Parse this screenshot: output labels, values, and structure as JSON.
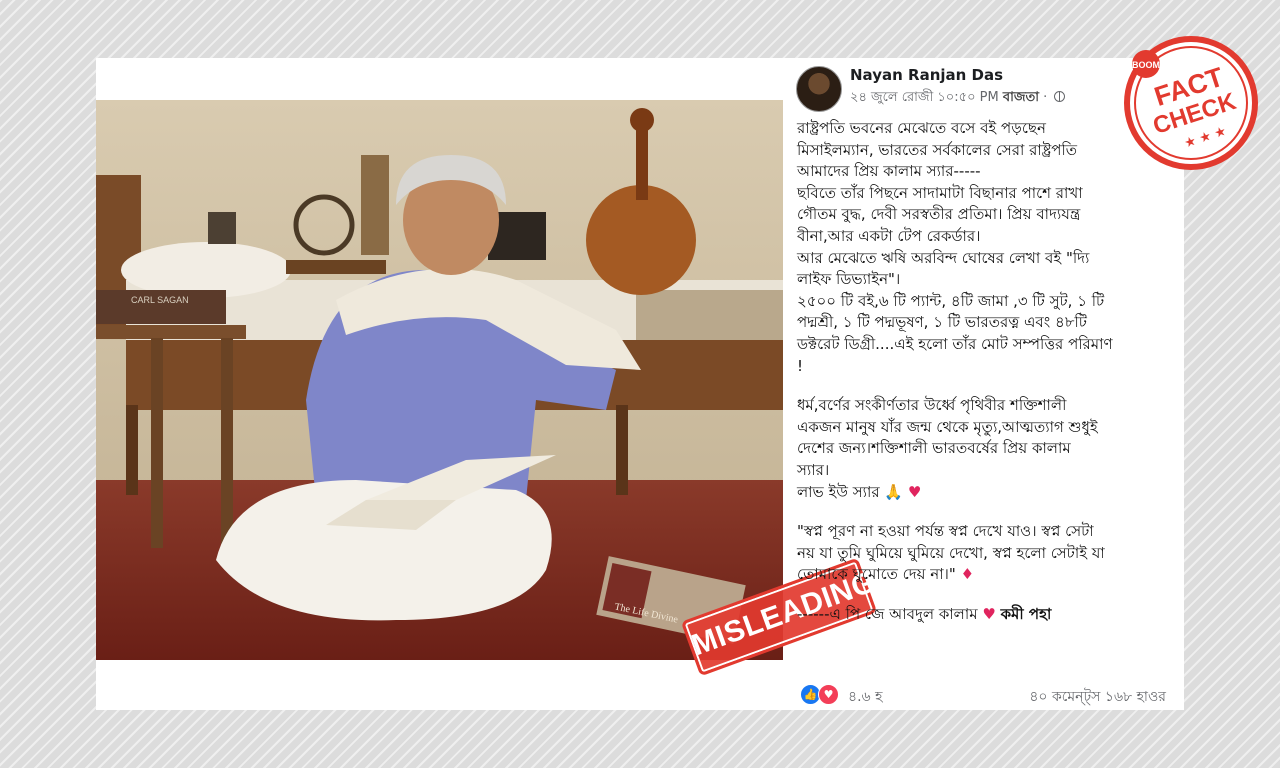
{
  "post": {
    "author": "Nayan Ranjan Das",
    "date": "২৪ জুলে রোজী ১০:৫০ PM",
    "place": "বাজতা",
    "paragraphs": [
      "রাষ্ট্রপতি ভবনের মেঝেতে বসে বই পড়ছেন",
      "মিসাইলম্যান, ভারতের সর্বকালের সেরা রাষ্ট্রপতি",
      "আমাদের প্রিয় কালাম স্যার-----",
      "ছবিতে তাঁর পিছনে সাদামাটা বিছানার পাশে রাখা",
      "গৌতম বুদ্ধ, দেবী সরস্বতীর প্রতিমা। প্রিয় বাদ্যযন্ত্র",
      "বীনা,আর একটা টেপ রেকর্ডার।",
      "আর মেঝেতে ঋষি অরবিন্দ ঘোষের লেখা বই \"দ্যি",
      "লাইফ ডিভ্যাইন\"।",
      "২৫০০ টি বই,৬ টি প্যান্ট, ৪টি জামা ,৩ টি সুট, ১ টি",
      "পদ্মশ্রী, ১ টি পদ্মভূষণ, ১ টি ভারতরত্ন এবং ৪৮টি",
      "ডক্টরেট ডিগ্রী....এই হলো তাঁর মোট সম্পত্তির পরিমাণ",
      "!"
    ],
    "paragraph2": [
      "ধর্ম,বর্ণের সংকীর্ণতার উর্ধ্বে পৃথিবীর শক্তিশালী",
      "একজন মানুষ যাঁর জন্ম থেকে মৃত্যু,আত্মত্যাগ শুধুই",
      "দেশের জন্য।শক্তিশালী ভারতবর্ষের প্রিয় কালাম",
      "স্যার।"
    ],
    "love_line": "লাভ ইউ স্যার 🙏",
    "quote": [
      "\"স্বপ্ন পূরণ না হওয়া পর্যন্ত স্বপ্ন দেখে যাও। স্বপ্ন সেটা",
      "নয় যা তুমি ঘুমিয়ে ঘুমিয়ে দেখো, স্বপ্ন হলো সেটাই যা",
      "তোমাকে ঘুমোতে দেয় না।\""
    ],
    "signature": "------এ পি জে আবদুল কালাম",
    "signature_tail": "কমী পহা",
    "reactions_count": "৪.৬ হ",
    "comments_shares": "৪০ কমেন্ট্স ১৬৮ হাওর"
  },
  "stamps": {
    "misleading": "MISLEADING",
    "fact": "FACT",
    "check": "CHECK",
    "brand": "BOOM"
  },
  "book_titles": {
    "shelf_book": "CARL SAGAN",
    "floor_book": "The Life Divine"
  },
  "icons": [
    "globe-icon",
    "like-icon",
    "love-icon",
    "heart-icon",
    "pray-icon",
    "diamond-icon"
  ],
  "colors": {
    "stamp_red": "#e23a2f",
    "link_blue": "#1877f2"
  }
}
